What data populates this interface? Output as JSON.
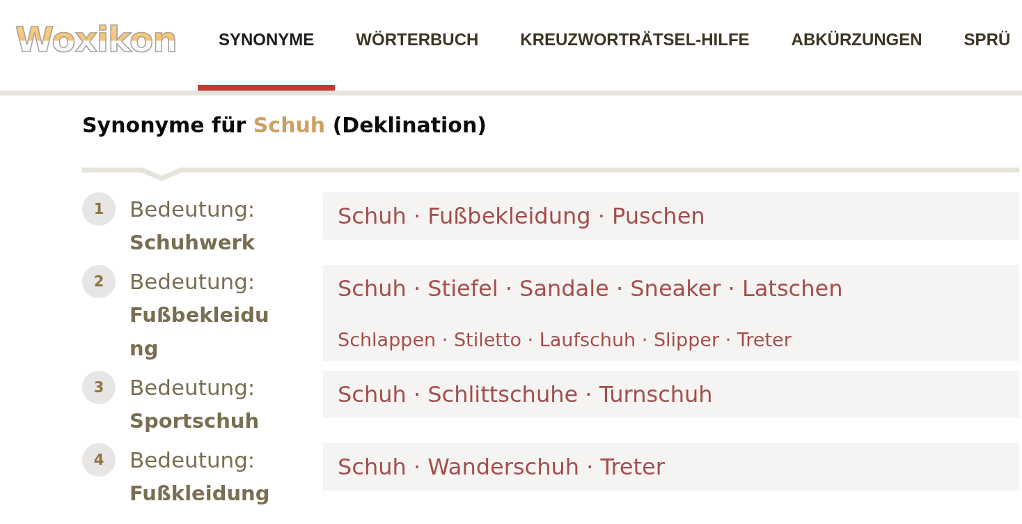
{
  "header": {
    "logo": "Woxikon",
    "tabs": [
      {
        "label": "SYNONYME",
        "selected": true
      },
      {
        "label": "WÖRTERBUCH",
        "selected": false
      },
      {
        "label": "KREUZWORTRÄTSEL-HILFE",
        "selected": false
      },
      {
        "label": "ABKÜRZUNGEN",
        "selected": false
      },
      {
        "label": "SPRÜ",
        "selected": false
      }
    ]
  },
  "heading": {
    "text_before": "Synonyme für",
    "headword": "Schuh",
    "text_after": "(Deklination)"
  },
  "meanings": [
    {
      "number": "1",
      "label": "Bedeutung:",
      "term": "Schuhwerk",
      "synonym_groups": [
        {
          "kind": "primary",
          "separator": "·",
          "words": [
            "Schuh",
            "Fußbekleidung",
            "Puschen"
          ]
        }
      ]
    },
    {
      "number": "2",
      "label": "Bedeutung:",
      "term": "Fußbekleidung",
      "synonym_groups": [
        {
          "kind": "primary",
          "separator": "·",
          "words": [
            "Schuh",
            "Stiefel",
            "Sandale",
            "Sneaker",
            "Latschen"
          ]
        },
        {
          "kind": "secondary",
          "separator": "·",
          "words": [
            "Schlappen",
            "Stiletto",
            "Laufschuh",
            "Slipper",
            "Treter"
          ]
        }
      ]
    },
    {
      "number": "3",
      "label": "Bedeutung:",
      "term": "Sportschuh",
      "synonym_groups": [
        {
          "kind": "primary",
          "separator": "·",
          "words": [
            "Schuh",
            "Schlittschuhe",
            "Turnschuh"
          ]
        }
      ]
    },
    {
      "number": "4",
      "label": "Bedeutung:",
      "term": "Fußkleidung",
      "synonym_groups": [
        {
          "kind": "primary",
          "separator": "·",
          "words": [
            "Schuh",
            "Wanderschuh",
            "Treter"
          ]
        }
      ]
    }
  ]
}
